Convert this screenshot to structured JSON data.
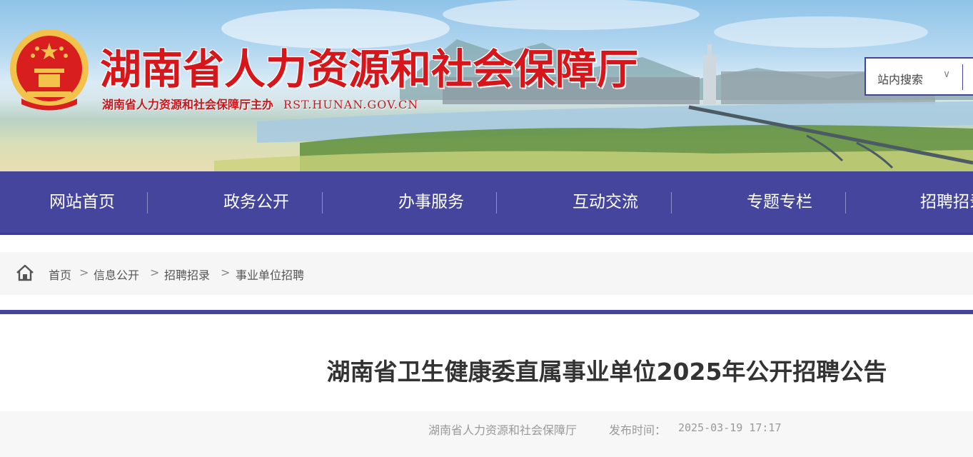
{
  "header": {
    "site_title": "湖南省人力资源和社会保障厅",
    "site_subtitle": "湖南省人力资源和社会保障厅主办",
    "site_domain": "RST.HUNAN.GOV.CN",
    "search_select": "站内搜索",
    "search_caret": "∨"
  },
  "nav": {
    "items": [
      "网站首页",
      "政务公开",
      "办事服务",
      "互动交流",
      "专题专栏",
      "招聘招录"
    ]
  },
  "breadcrumb": {
    "items": [
      "首页",
      "信息公开",
      "招聘招录",
      "事业单位招聘"
    ],
    "separator": ">"
  },
  "article": {
    "title": "湖南省卫生健康委直属事业单位2025年公开招聘公告",
    "source": "湖南省人力资源和社会保障厅",
    "publish_label": "发布时间：",
    "publish_time": "2025-03-19 17:17"
  },
  "colors": {
    "nav_bg": "#45459e",
    "title_red": "#d6161b",
    "emblem_gold": "#f2c24a"
  }
}
